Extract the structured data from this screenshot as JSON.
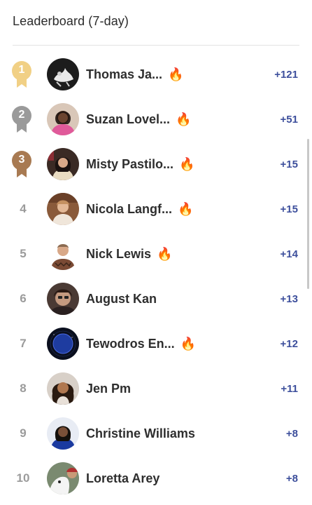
{
  "header": {
    "title": "Leaderboard (7-day)"
  },
  "colors": {
    "gold": "#f1d085",
    "silver": "#9a9a9a",
    "bronze": "#a87a52",
    "score": "#3d4f9c"
  },
  "entries": [
    {
      "rank": "1",
      "name": "Thomas Ja...",
      "score": "+121",
      "fire": "🔥",
      "badge": "gold"
    },
    {
      "rank": "2",
      "name": "Suzan Lovel...",
      "score": "+51",
      "fire": "🔥",
      "badge": "silver"
    },
    {
      "rank": "3",
      "name": "Misty Pastilo...",
      "score": "+15",
      "fire": "🔥",
      "badge": "bronze"
    },
    {
      "rank": "4",
      "name": "Nicola Langf...",
      "score": "+15",
      "fire": "🔥",
      "badge": ""
    },
    {
      "rank": "5",
      "name": "Nick Lewis",
      "score": "+14",
      "fire": "🔥",
      "badge": ""
    },
    {
      "rank": "6",
      "name": "August Kan",
      "score": "+13",
      "fire": "",
      "badge": ""
    },
    {
      "rank": "7",
      "name": "Tewodros En...",
      "score": "+12",
      "fire": "🔥",
      "badge": ""
    },
    {
      "rank": "8",
      "name": "Jen Pm",
      "score": "+11",
      "fire": "",
      "badge": ""
    },
    {
      "rank": "9",
      "name": "Christine Williams",
      "score": "+8",
      "fire": "",
      "badge": ""
    },
    {
      "rank": "10",
      "name": "Loretta Arey",
      "score": "+8",
      "fire": "",
      "badge": ""
    }
  ]
}
